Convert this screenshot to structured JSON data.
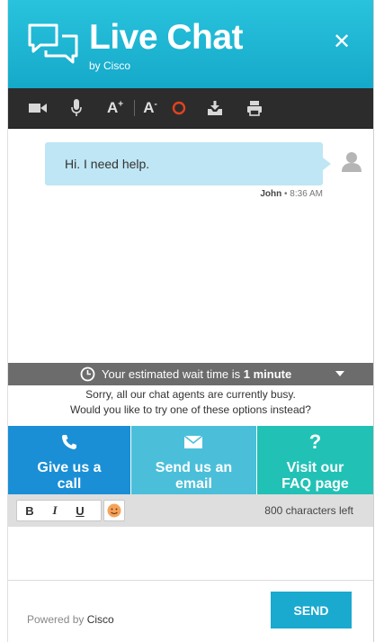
{
  "header": {
    "title": "Live Chat",
    "subtitle": "by Cisco",
    "close_glyph": "✕",
    "logo_icon": "chat-bubbles-icon",
    "background": "#1fb3d0"
  },
  "toolbar": {
    "font_increase": "A",
    "font_decrease": "A",
    "plus": "+",
    "minus": "-",
    "icons": [
      "video-camera-icon",
      "microphone-icon",
      "font-increase-icon",
      "font-decrease-icon",
      "record-icon",
      "download-icon",
      "print-icon"
    ],
    "record_color": "#e0431f"
  },
  "messages": [
    {
      "text": "Hi. I need help.",
      "author": "John",
      "separator": "•",
      "time": "8:36 AM"
    }
  ],
  "wait": {
    "prefix": "Your estimated wait time is",
    "value": "1 minute"
  },
  "busy": {
    "line1": "Sorry, all our chat agents are currently busy.",
    "line2": "Would you like to try one of these options instead?"
  },
  "options": [
    {
      "label": "Give us a\ncall",
      "icon": "phone-icon",
      "color": "#1a8fd6"
    },
    {
      "label": "Send us an\nemail",
      "icon": "envelope-icon",
      "color": "#4bbfd9"
    },
    {
      "label": "Visit our\nFAQ page",
      "icon": "question-icon",
      "glyph": "?",
      "color": "#22c1b6"
    }
  ],
  "format": {
    "bold": "B",
    "italic": "I",
    "underline": "U",
    "chars_left": "800 characters left"
  },
  "input": {
    "value": ""
  },
  "footer": {
    "powered_prefix": "Powered by",
    "brand": "Cisco",
    "send_label": "SEND"
  }
}
